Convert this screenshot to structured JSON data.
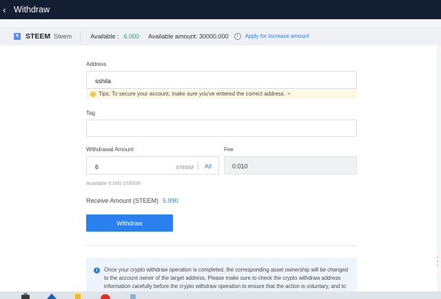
{
  "header": {
    "title": "Withdraw",
    "back_icon": "chevron-left-icon"
  },
  "coin_bar": {
    "symbol": "STEEM",
    "name": "Steem",
    "available_label": "Available :",
    "available_value": "6.000",
    "available_amount_text": "Available amount: 30000.000",
    "apply_link": "Apply for increase amount"
  },
  "form": {
    "address_label": "Address",
    "address_value": "sshila",
    "tips": "Tips: To secure your account, make sure you've entered the correct address.",
    "tips_arrow": ">",
    "tag_label": "Tag",
    "tag_value": "",
    "amount_label": "Withdrawal Amount",
    "amount_value": "6",
    "amount_unit": "STEEM",
    "all_label": "All",
    "fee_label": "Fee",
    "fee_value": "0.010",
    "available_note": "Available 6.000 STEEM",
    "receive_label": "Receive Amount (STEEM)",
    "receive_value": "5.990",
    "withdraw_button": "Withdraw"
  },
  "notice": {
    "text": "Once your crypto withdraw operation is completed, the corresponding asset ownership will be changed to the account owner of the target address. Please make sure to check the crypto withdraw address information carefully before the crypto withdraw operation to ensure that the action is voluntary, and to"
  },
  "colors": {
    "header_bg": "#141e33",
    "accent": "#2a80ee",
    "available_green": "#1fa37a"
  }
}
